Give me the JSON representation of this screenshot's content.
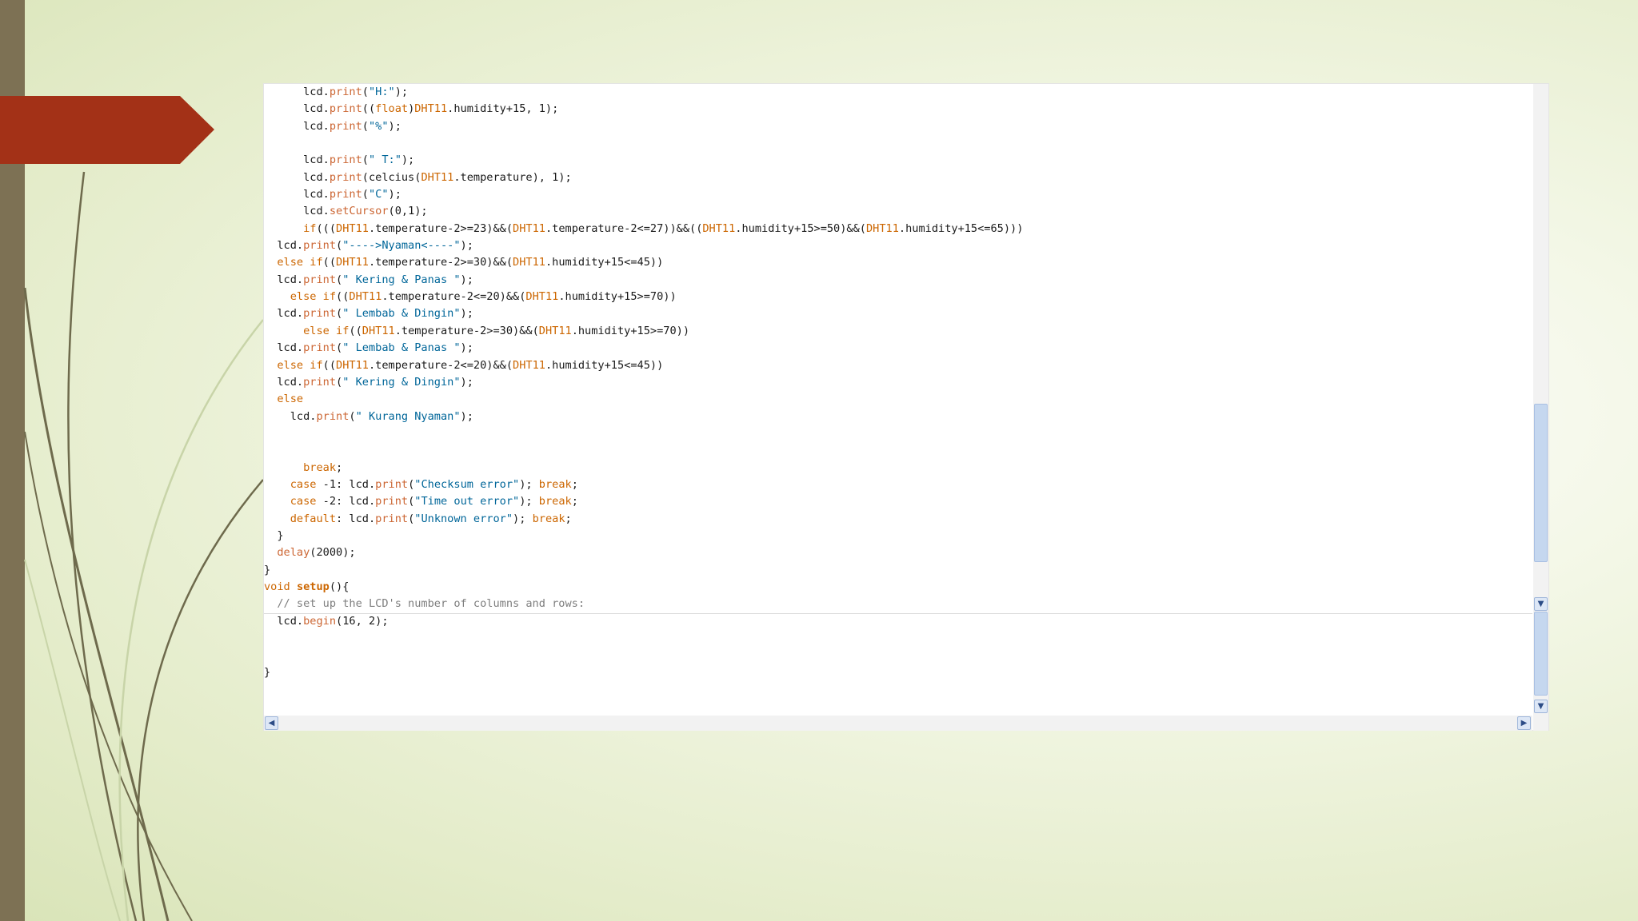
{
  "editor": {
    "lines": [
      [
        [
          "t-pl",
          "      lcd."
        ],
        [
          "t-fn",
          "print"
        ],
        [
          "t-pl",
          "("
        ],
        [
          "t-str",
          "\"H:\""
        ],
        [
          "t-pl",
          ");"
        ]
      ],
      [
        [
          "t-pl",
          "      lcd."
        ],
        [
          "t-fn",
          "print"
        ],
        [
          "t-pl",
          "(("
        ],
        [
          "t-type",
          "float"
        ],
        [
          "t-pl",
          ")"
        ],
        [
          "t-kw",
          "DHT11"
        ],
        [
          "t-pl",
          ".humidity+15, 1);"
        ]
      ],
      [
        [
          "t-pl",
          "      lcd."
        ],
        [
          "t-fn",
          "print"
        ],
        [
          "t-pl",
          "("
        ],
        [
          "t-str",
          "\"%\""
        ],
        [
          "t-pl",
          ");"
        ]
      ],
      [],
      [
        [
          "t-pl",
          "      lcd."
        ],
        [
          "t-fn",
          "print"
        ],
        [
          "t-pl",
          "("
        ],
        [
          "t-str",
          "\" T:\""
        ],
        [
          "t-pl",
          ");"
        ]
      ],
      [
        [
          "t-pl",
          "      lcd."
        ],
        [
          "t-fn",
          "print"
        ],
        [
          "t-pl",
          "(celcius("
        ],
        [
          "t-kw",
          "DHT11"
        ],
        [
          "t-pl",
          ".temperature), 1);"
        ]
      ],
      [
        [
          "t-pl",
          "      lcd."
        ],
        [
          "t-fn",
          "print"
        ],
        [
          "t-pl",
          "("
        ],
        [
          "t-str",
          "\"C\""
        ],
        [
          "t-pl",
          ");"
        ]
      ],
      [
        [
          "t-pl",
          "      lcd."
        ],
        [
          "t-fn",
          "setCursor"
        ],
        [
          "t-pl",
          "(0,1);"
        ]
      ],
      [
        [
          "t-pl",
          "      "
        ],
        [
          "t-kw",
          "if"
        ],
        [
          "t-pl",
          "((("
        ],
        [
          "t-kw",
          "DHT11"
        ],
        [
          "t-pl",
          ".temperature-2>=23)&&("
        ],
        [
          "t-kw",
          "DHT11"
        ],
        [
          "t-pl",
          ".temperature-2<=27))&&(("
        ],
        [
          "t-kw",
          "DHT11"
        ],
        [
          "t-pl",
          ".humidity+15>=50)&&("
        ],
        [
          "t-kw",
          "DHT11"
        ],
        [
          "t-pl",
          ".humidity+15<=65)))"
        ]
      ],
      [
        [
          "t-pl",
          "  lcd."
        ],
        [
          "t-fn",
          "print"
        ],
        [
          "t-pl",
          "("
        ],
        [
          "t-str",
          "\"---->Nyaman<----\""
        ],
        [
          "t-pl",
          ");"
        ]
      ],
      [
        [
          "t-pl",
          "  "
        ],
        [
          "t-kw",
          "else if"
        ],
        [
          "t-pl",
          "(("
        ],
        [
          "t-kw",
          "DHT11"
        ],
        [
          "t-pl",
          ".temperature-2>=30)&&("
        ],
        [
          "t-kw",
          "DHT11"
        ],
        [
          "t-pl",
          ".humidity+15<=45))"
        ]
      ],
      [
        [
          "t-pl",
          "  lcd."
        ],
        [
          "t-fn",
          "print"
        ],
        [
          "t-pl",
          "("
        ],
        [
          "t-str",
          "\" Kering & Panas \""
        ],
        [
          "t-pl",
          ");"
        ]
      ],
      [
        [
          "t-pl",
          "    "
        ],
        [
          "t-kw",
          "else if"
        ],
        [
          "t-pl",
          "(("
        ],
        [
          "t-kw",
          "DHT11"
        ],
        [
          "t-pl",
          ".temperature-2<=20)&&("
        ],
        [
          "t-kw",
          "DHT11"
        ],
        [
          "t-pl",
          ".humidity+15>=70))"
        ]
      ],
      [
        [
          "t-pl",
          "  lcd."
        ],
        [
          "t-fn",
          "print"
        ],
        [
          "t-pl",
          "("
        ],
        [
          "t-str",
          "\" Lembab & Dingin\""
        ],
        [
          "t-pl",
          ");"
        ]
      ],
      [
        [
          "t-pl",
          "      "
        ],
        [
          "t-kw",
          "else if"
        ],
        [
          "t-pl",
          "(("
        ],
        [
          "t-kw",
          "DHT11"
        ],
        [
          "t-pl",
          ".temperature-2>=30)&&("
        ],
        [
          "t-kw",
          "DHT11"
        ],
        [
          "t-pl",
          ".humidity+15>=70))"
        ]
      ],
      [
        [
          "t-pl",
          "  lcd."
        ],
        [
          "t-fn",
          "print"
        ],
        [
          "t-pl",
          "("
        ],
        [
          "t-str",
          "\" Lembab & Panas \""
        ],
        [
          "t-pl",
          ");"
        ]
      ],
      [
        [
          "t-pl",
          "  "
        ],
        [
          "t-kw",
          "else if"
        ],
        [
          "t-pl",
          "(("
        ],
        [
          "t-kw",
          "DHT11"
        ],
        [
          "t-pl",
          ".temperature-2<=20)&&("
        ],
        [
          "t-kw",
          "DHT11"
        ],
        [
          "t-pl",
          ".humidity+15<=45))"
        ]
      ],
      [
        [
          "t-pl",
          "  lcd."
        ],
        [
          "t-fn",
          "print"
        ],
        [
          "t-pl",
          "("
        ],
        [
          "t-str",
          "\" Kering & Dingin\""
        ],
        [
          "t-pl",
          ");"
        ]
      ],
      [
        [
          "t-pl",
          "  "
        ],
        [
          "t-kw",
          "else"
        ]
      ],
      [
        [
          "t-pl",
          "    lcd."
        ],
        [
          "t-fn",
          "print"
        ],
        [
          "t-pl",
          "("
        ],
        [
          "t-str",
          "\" Kurang Nyaman\""
        ],
        [
          "t-pl",
          ");"
        ]
      ],
      [],
      [],
      [
        [
          "t-pl",
          "      "
        ],
        [
          "t-kw",
          "break"
        ],
        [
          "t-pl",
          ";"
        ]
      ],
      [
        [
          "t-pl",
          "    "
        ],
        [
          "t-kw",
          "case"
        ],
        [
          "t-pl",
          " -1: lcd."
        ],
        [
          "t-fn",
          "print"
        ],
        [
          "t-pl",
          "("
        ],
        [
          "t-str",
          "\"Checksum error\""
        ],
        [
          "t-pl",
          "); "
        ],
        [
          "t-kw",
          "break"
        ],
        [
          "t-pl",
          ";"
        ]
      ],
      [
        [
          "t-pl",
          "    "
        ],
        [
          "t-kw",
          "case"
        ],
        [
          "t-pl",
          " -2: lcd."
        ],
        [
          "t-fn",
          "print"
        ],
        [
          "t-pl",
          "("
        ],
        [
          "t-str",
          "\"Time out error\""
        ],
        [
          "t-pl",
          "); "
        ],
        [
          "t-kw",
          "break"
        ],
        [
          "t-pl",
          ";"
        ]
      ],
      [
        [
          "t-pl",
          "    "
        ],
        [
          "t-kw",
          "default"
        ],
        [
          "t-pl",
          ": lcd."
        ],
        [
          "t-fn",
          "print"
        ],
        [
          "t-pl",
          "("
        ],
        [
          "t-str",
          "\"Unknown error\""
        ],
        [
          "t-pl",
          "); "
        ],
        [
          "t-kw",
          "break"
        ],
        [
          "t-pl",
          ";"
        ]
      ],
      [
        [
          "t-pl",
          "  }"
        ]
      ],
      [
        [
          "t-pl",
          "  "
        ],
        [
          "t-fn",
          "delay"
        ],
        [
          "t-pl",
          "(2000);"
        ]
      ],
      [
        [
          "t-pl",
          "}"
        ]
      ],
      [
        [
          "t-type",
          "void"
        ],
        [
          "t-pl",
          " "
        ],
        [
          "t-kwb",
          "setup"
        ],
        [
          "t-pl",
          "(){"
        ]
      ],
      [
        [
          "t-pl",
          "  "
        ],
        [
          "t-cm",
          "// set up the LCD's number of columns and rows:"
        ]
      ],
      [
        [
          "t-pl",
          "  lcd."
        ],
        [
          "t-fn",
          "begin"
        ],
        [
          "t-pl",
          "(16, 2);"
        ]
      ],
      [],
      [],
      [
        [
          "t-pl",
          "}"
        ]
      ]
    ]
  },
  "scrollbars": {
    "vertical_down_glyph": "▼",
    "horizontal_left_glyph": "◀",
    "horizontal_right_glyph": "▶"
  }
}
